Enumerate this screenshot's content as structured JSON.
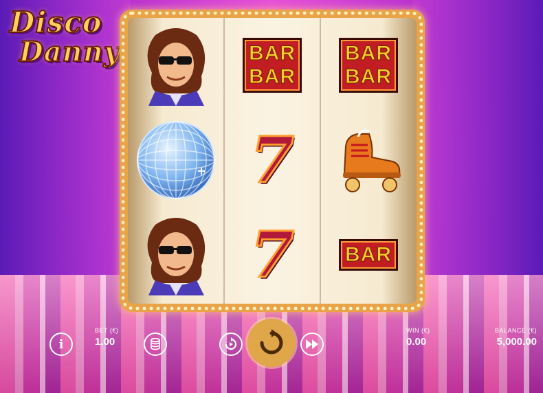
{
  "game": {
    "logo": {
      "line1": "Disco",
      "line2": "Danny"
    }
  },
  "reels": [
    {
      "symbols": [
        "danny-character",
        "disco-ball",
        "danny-character"
      ]
    },
    {
      "symbols": [
        "double-bar",
        "seven",
        "seven"
      ]
    },
    {
      "symbols": [
        "double-bar",
        "roller-skate",
        "single-bar"
      ]
    }
  ],
  "symbols": {
    "bar_text": "BAR",
    "seven_text": "7"
  },
  "hud": {
    "info_icon": "i",
    "bet_label": "BET (€)",
    "bet_value": "1.00",
    "win_label": "WIN (€)",
    "win_value": "0.00",
    "balance_label": "BALANCE (€)",
    "balance_value": "5,000.00"
  },
  "colors": {
    "accent": "#e0a64a",
    "bar_red": "#c31d24",
    "bar_gold": "#ffce2e",
    "seven_red": "#b2183a"
  }
}
